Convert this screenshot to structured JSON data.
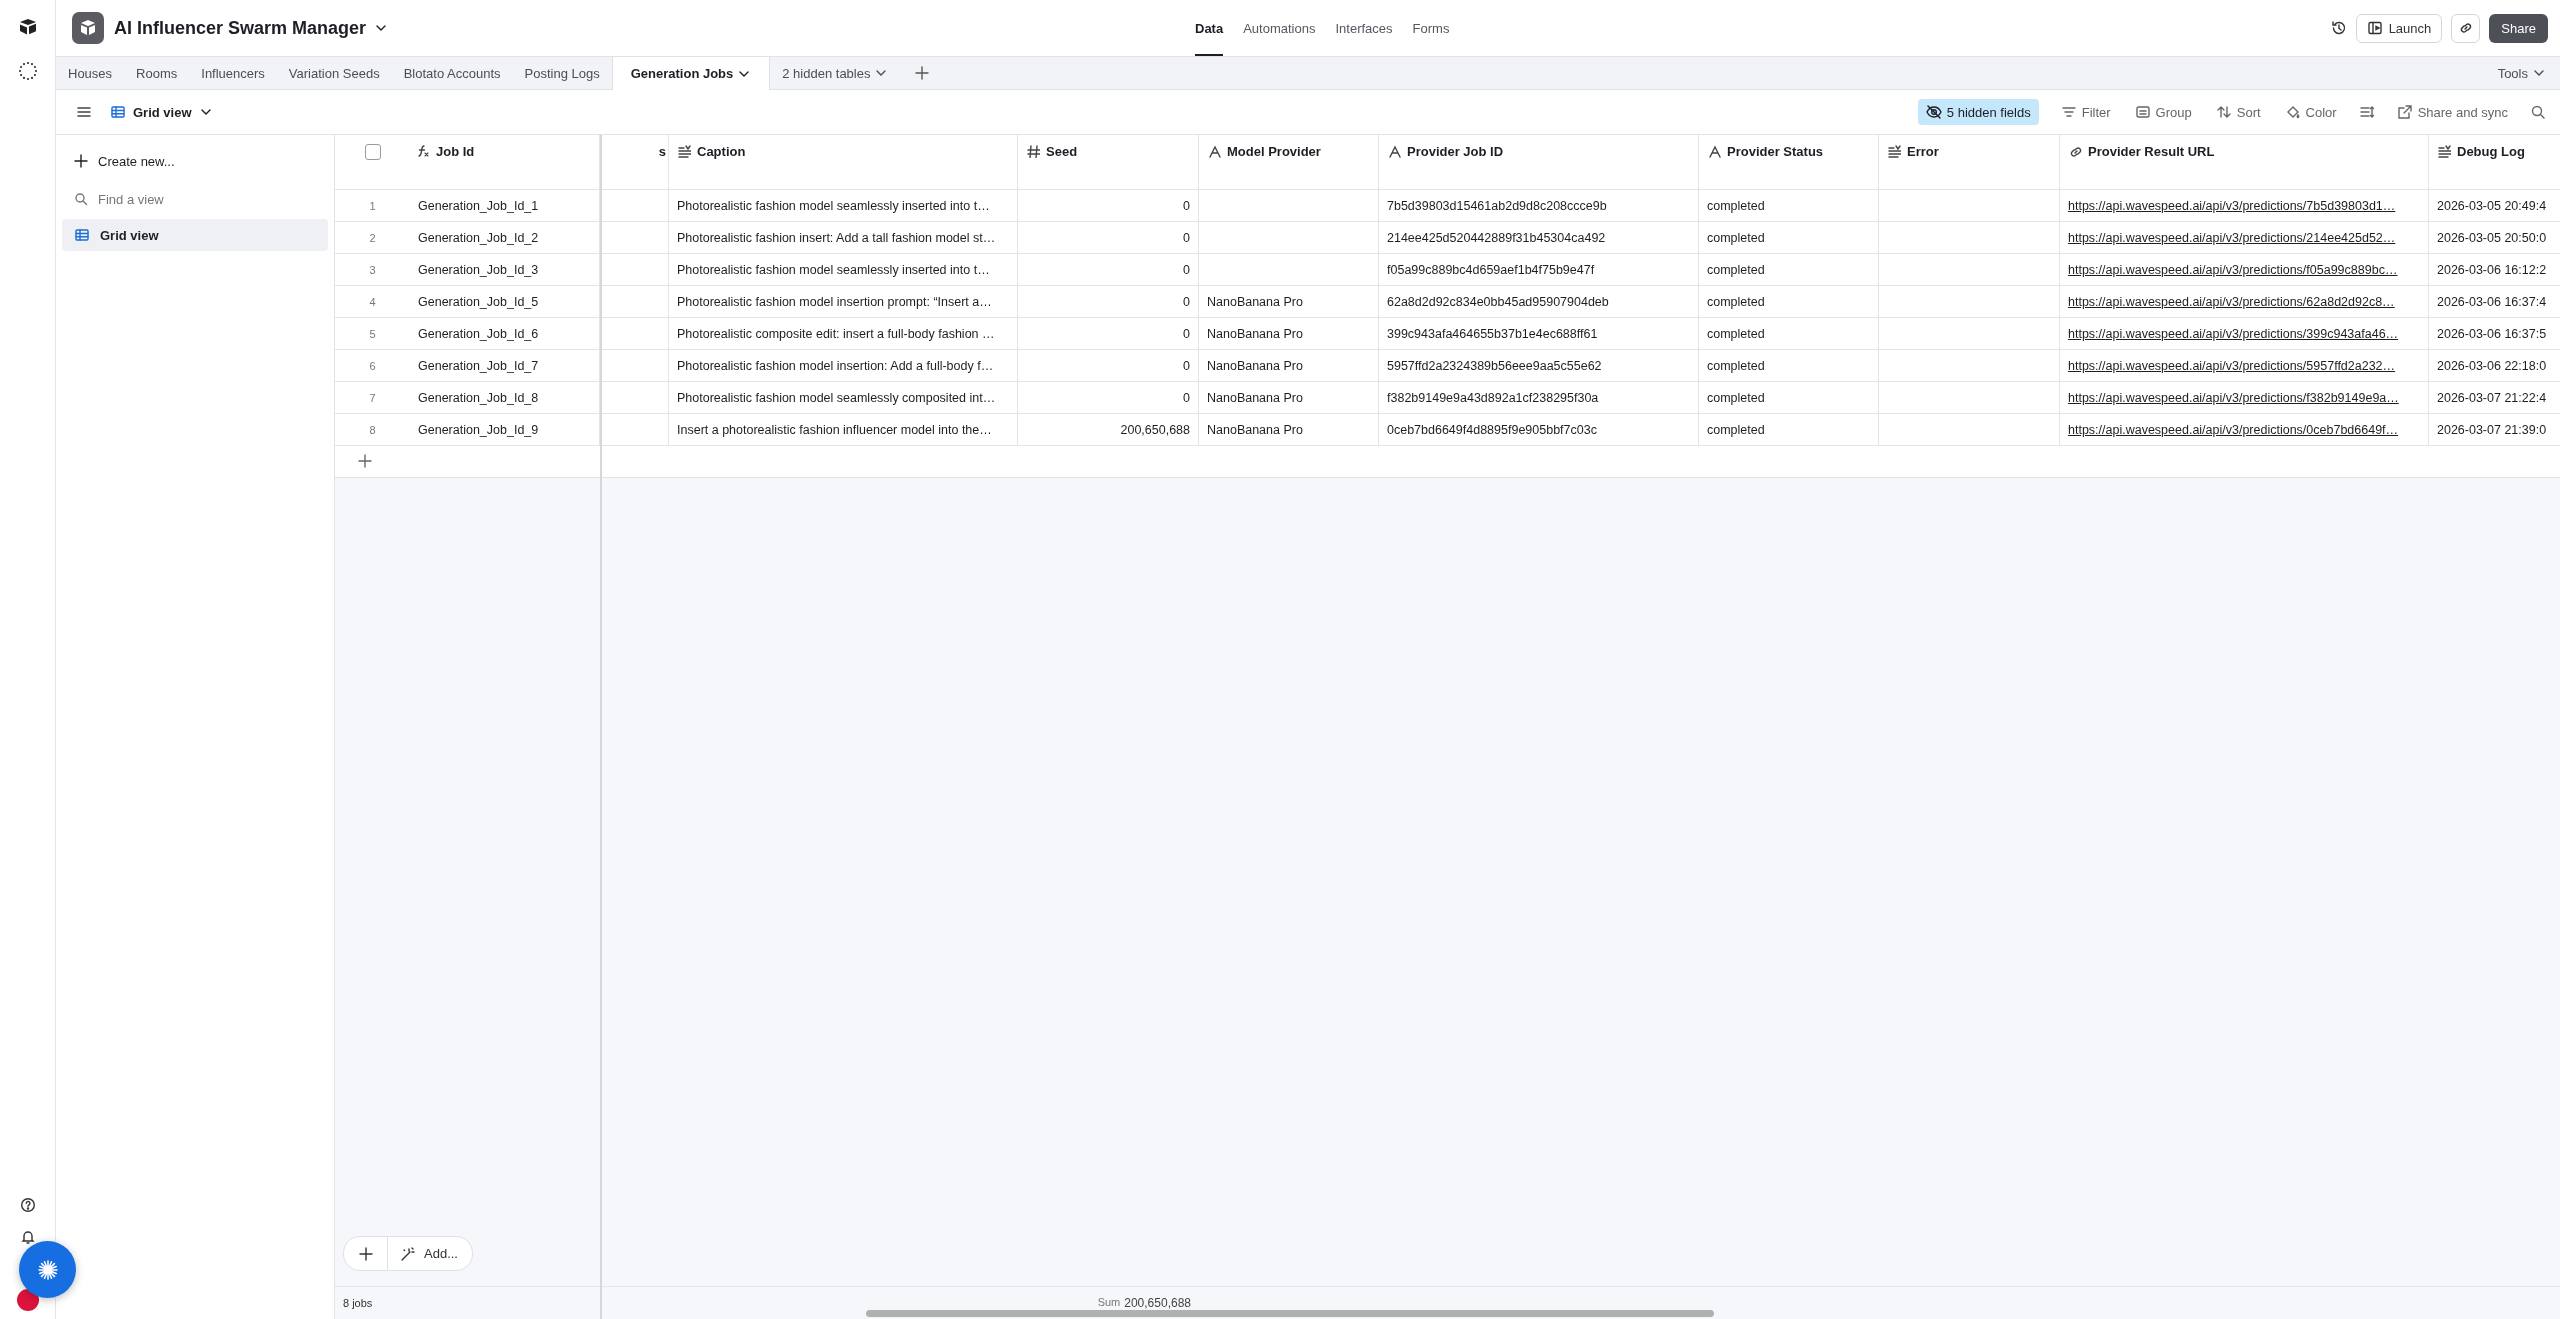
{
  "base": {
    "title": "AI Influencer Swarm Manager"
  },
  "nav": [
    {
      "label": "Data",
      "selected": true
    },
    {
      "label": "Automations",
      "selected": false
    },
    {
      "label": "Interfaces",
      "selected": false
    },
    {
      "label": "Forms",
      "selected": false
    }
  ],
  "launch_button": "Launch",
  "share_button": "Share",
  "tables": [
    {
      "label": "Houses",
      "selected": false
    },
    {
      "label": "Rooms",
      "selected": false
    },
    {
      "label": "Influencers",
      "selected": false
    },
    {
      "label": "Variation Seeds",
      "selected": false
    },
    {
      "label": "Blotato Accounts",
      "selected": false
    },
    {
      "label": "Posting Logs",
      "selected": false
    },
    {
      "label": "Generation Jobs",
      "selected": true
    }
  ],
  "hidden_tables": "2 hidden tables",
  "tools": "Tools",
  "view": {
    "name": "Grid view"
  },
  "toolbar": [
    {
      "kind": "hidden",
      "label": "5 hidden fields",
      "active": true
    },
    {
      "kind": "filter",
      "label": "Filter",
      "active": false
    },
    {
      "kind": "group",
      "label": "Group",
      "active": false
    },
    {
      "kind": "sort",
      "label": "Sort",
      "active": false
    },
    {
      "kind": "color",
      "label": "Color",
      "active": false
    },
    {
      "kind": "share",
      "label": "Share and sync",
      "active": false
    }
  ],
  "sidebar": {
    "create": "Create new...",
    "search_placeholder": "Find a view",
    "views": [
      {
        "name": "Grid view",
        "selected": true
      }
    ]
  },
  "table": {
    "select_all_checked": false,
    "columns": [
      {
        "label": "Job Id",
        "kind": "formula",
        "frozen": true
      },
      {
        "label": "s",
        "kind": "none",
        "frozen": false
      },
      {
        "label": "Caption",
        "kind": "longtext",
        "frozen": false
      },
      {
        "label": "Seed",
        "kind": "number",
        "frozen": false
      },
      {
        "label": "Model Provider",
        "kind": "text",
        "frozen": false
      },
      {
        "label": "Provider Job ID",
        "kind": "text",
        "frozen": false
      },
      {
        "label": "Provider Status",
        "kind": "text",
        "frozen": false
      },
      {
        "label": "Error",
        "kind": "longtext",
        "frozen": false
      },
      {
        "label": "Provider Result URL",
        "kind": "url",
        "frozen": false
      },
      {
        "label": "Debug Log",
        "kind": "longtext",
        "frozen": false
      }
    ],
    "rows": [
      {
        "number": "1",
        "cells": [
          "Generation_Job_Id_1",
          null,
          "Photorealistic fashion model seamlessly inserted into t…",
          "0",
          null,
          "7b5d39803d15461ab2d9d8c208ccce9b",
          "completed",
          null,
          "https://api.wavespeed.ai/api/v3/predictions/7b5d39803d1…",
          "2026-03-05 20:49:4"
        ]
      },
      {
        "number": "2",
        "cells": [
          "Generation_Job_Id_2",
          null,
          "Photorealistic fashion insert: Add a tall fashion model st…",
          "0",
          null,
          "214ee425d520442889f31b45304ca492",
          "completed",
          null,
          "https://api.wavespeed.ai/api/v3/predictions/214ee425d52…",
          "2026-03-05 20:50:0"
        ]
      },
      {
        "number": "3",
        "cells": [
          "Generation_Job_Id_3",
          null,
          "Photorealistic fashion model seamlessly inserted into t…",
          "0",
          null,
          "f05a99c889bc4d659aef1b4f75b9e47f",
          "completed",
          null,
          "https://api.wavespeed.ai/api/v3/predictions/f05a99c889bc…",
          "2026-03-06 16:12:2"
        ]
      },
      {
        "number": "4",
        "cells": [
          "Generation_Job_Id_5",
          null,
          "Photorealistic fashion model insertion prompt: “Insert a…",
          "0",
          "NanoBanana Pro",
          "62a8d2d92c834e0bb45ad95907904deb",
          "completed",
          null,
          "https://api.wavespeed.ai/api/v3/predictions/62a8d2d92c8…",
          "2026-03-06 16:37:4"
        ]
      },
      {
        "number": "5",
        "cells": [
          "Generation_Job_Id_6",
          null,
          "Photorealistic composite edit: insert a full-body fashion …",
          "0",
          "NanoBanana Pro",
          "399c943afa464655b37b1e4ec688ff61",
          "completed",
          null,
          "https://api.wavespeed.ai/api/v3/predictions/399c943afa46…",
          "2026-03-06 16:37:5"
        ]
      },
      {
        "number": "6",
        "cells": [
          "Generation_Job_Id_7",
          null,
          "Photorealistic fashion model insertion: Add a full-body f…",
          "0",
          "NanoBanana Pro",
          "5957ffd2a2324389b56eee9aa5c55e62",
          "completed",
          null,
          "https://api.wavespeed.ai/api/v3/predictions/5957ffd2a232…",
          "2026-03-06 22:18:0"
        ]
      },
      {
        "number": "7",
        "cells": [
          "Generation_Job_Id_8",
          null,
          "Photorealistic fashion model seamlessly composited int…",
          "0",
          "NanoBanana Pro",
          "f382b9149e9a43d892a1cf238295f30a",
          "completed",
          null,
          "https://api.wavespeed.ai/api/v3/predictions/f382b9149e9a…",
          "2026-03-07 21:22:4"
        ]
      },
      {
        "number": "8",
        "cells": [
          "Generation_Job_Id_9",
          null,
          "Insert a photorealistic fashion influencer model into the…",
          "200,650,688",
          "NanoBanana Pro",
          "0ceb7bd6649f4d8895f9e905bbf7c03c",
          "completed",
          null,
          "https://api.wavespeed.ai/api/v3/predictions/0ceb7bd6649f…",
          "2026-03-07 21:39:0"
        ]
      }
    ]
  },
  "add_menu": {
    "label": "Add..."
  },
  "footer": {
    "count": "8 jobs",
    "summary_label": "Sum",
    "summary_value": "200,650,688"
  }
}
